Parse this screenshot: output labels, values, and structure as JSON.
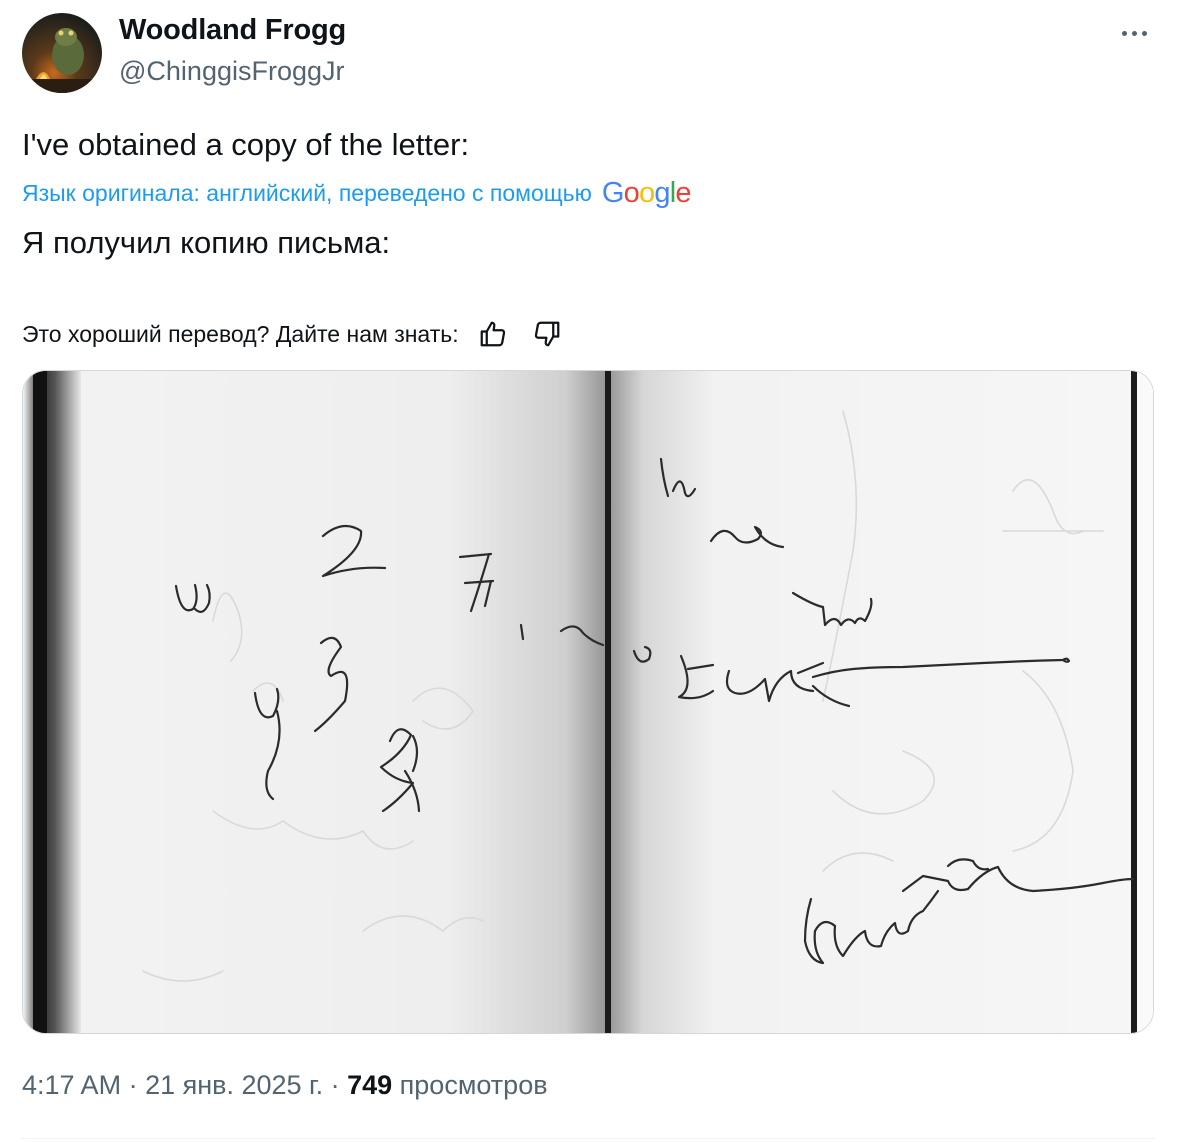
{
  "author": {
    "name": "Woodland Frogg",
    "handle": "@ChinggisFroggJr",
    "avatar_icon": "frog-campfire-avatar"
  },
  "post": {
    "text": "I've obtained a copy of the letter:",
    "translation_note": "Язык оригинала: английский, переведено с помощью",
    "translation_provider": "Google",
    "translated_text": "Я получил копию письма:",
    "feedback_prompt": "Это хороший перевод? Дайте нам знать:"
  },
  "meta": {
    "time": "4:17 AM",
    "date": "21 янв. 2025 г.",
    "views": "749",
    "views_label": "просмотров"
  },
  "icons": {
    "more": "more-icon",
    "thumbs_up": "thumbs-up-icon",
    "thumbs_down": "thumbs-down-icon"
  },
  "colors": {
    "link": "#1d9bf0",
    "secondary_text": "#536471",
    "primary_text": "#0f1419"
  }
}
